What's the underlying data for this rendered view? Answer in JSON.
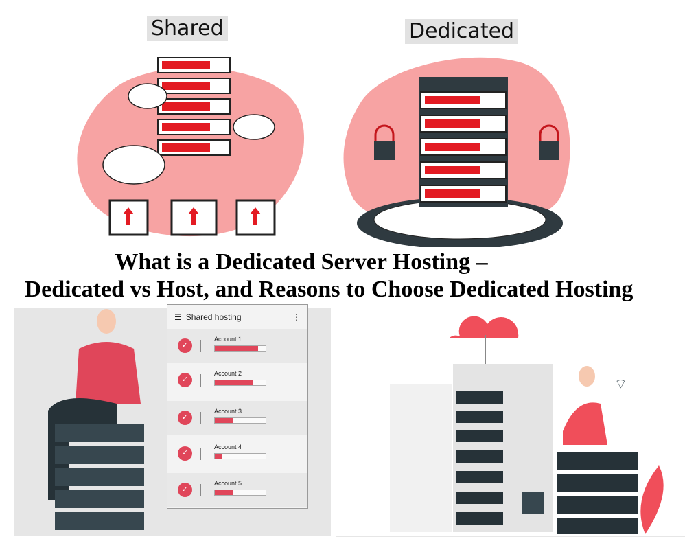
{
  "top_left": {
    "label": "Shared",
    "illustration": "shared-hosting-illustration",
    "server_units": 5,
    "clients": 3
  },
  "top_right": {
    "label": "Dedicated",
    "illustration": "dedicated-hosting-illustration",
    "server_units": 5,
    "locks": 2
  },
  "headline": {
    "line1": "What is a Dedicated Server Hosting –",
    "line2": "Dedicated vs Host, and Reasons to Choose Dedicated Hosting"
  },
  "shared_panel": {
    "title": "Shared hosting",
    "menu_icon": "more-vertical-icon",
    "accounts": [
      {
        "label": "Account 1",
        "usage_percent": 85
      },
      {
        "label": "Account 2",
        "usage_percent": 75
      },
      {
        "label": "Account 3",
        "usage_percent": 35
      },
      {
        "label": "Account 4",
        "usage_percent": 15
      },
      {
        "label": "Account 5",
        "usage_percent": 35
      }
    ]
  },
  "colors": {
    "accent_red": "#e0465a",
    "server_red": "#e31b23",
    "blob_pink": "#f7a3a3",
    "dark": "#2f3a40"
  }
}
